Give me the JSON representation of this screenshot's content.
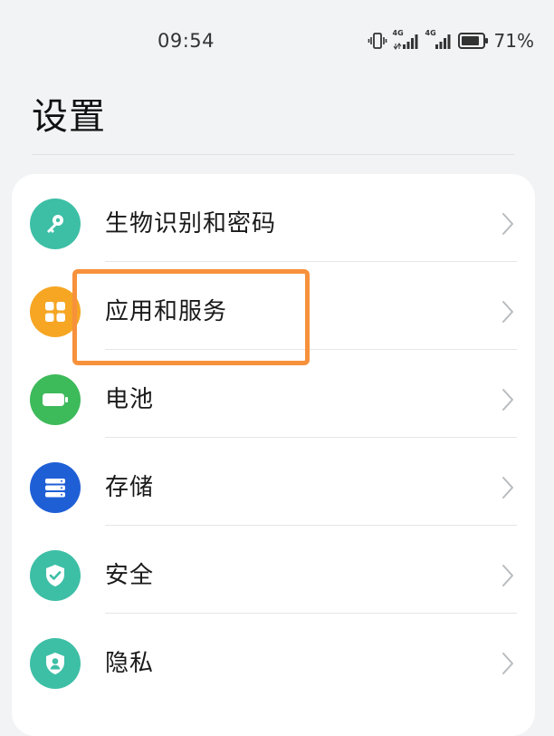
{
  "status_bar": {
    "time": "09:54",
    "battery_percent": "71%",
    "signal_1_label": "4G",
    "signal_2_label": "4G",
    "icons": [
      "vibrate-icon",
      "signal-4g-icon",
      "signal-4g-icon",
      "battery-icon"
    ]
  },
  "page": {
    "title": "设置"
  },
  "settings_items": [
    {
      "label": "生物识别和密码",
      "icon": "key-icon",
      "color": "#3dbfa6"
    },
    {
      "label": "应用和服务",
      "icon": "apps-grid-icon",
      "color": "#f6a623"
    },
    {
      "label": "电池",
      "icon": "battery-icon",
      "color": "#3dba5a"
    },
    {
      "label": "存储",
      "icon": "storage-icon",
      "color": "#1f5fd6"
    },
    {
      "label": "安全",
      "icon": "shield-check-icon",
      "color": "#3dbfa6"
    },
    {
      "label": "隐私",
      "icon": "privacy-shield-icon",
      "color": "#3dbfa6"
    }
  ],
  "annotation": {
    "highlight_color": "#f7913b",
    "highlighted_item": "应用和服务"
  }
}
